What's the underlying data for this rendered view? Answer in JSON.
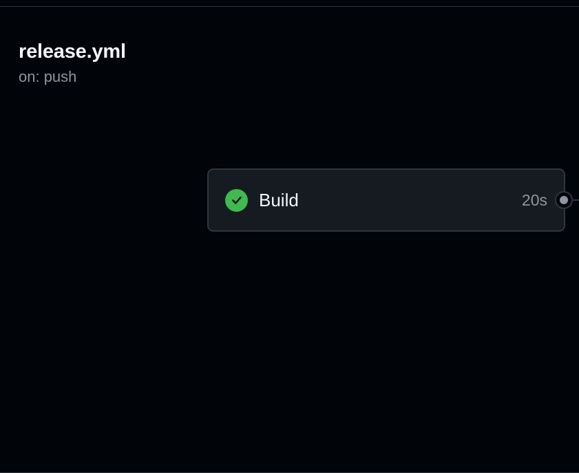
{
  "workflow": {
    "title": "release.yml",
    "trigger": "on: push"
  },
  "jobs": [
    {
      "name": "Build",
      "duration": "20s",
      "status": "success",
      "status_icon": "check-circle-icon",
      "status_color": "#3fb950"
    }
  ],
  "colors": {
    "background": "#010409",
    "card": "#161b22",
    "border": "#30363d",
    "text_primary": "#f0f6fc",
    "text_muted": "#8d96a0"
  }
}
